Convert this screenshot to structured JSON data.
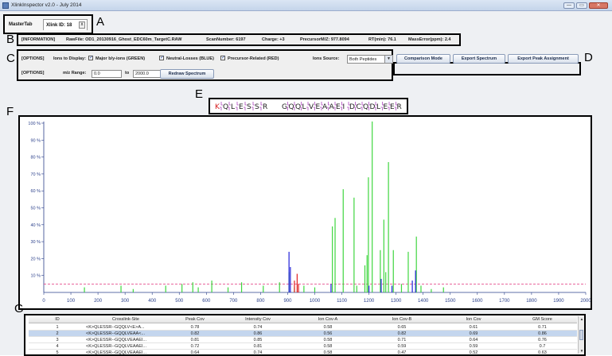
{
  "window": {
    "title": "XlinkInspector v2.0 - July 2014",
    "minimize_glyph": "—",
    "maximize_glyph": "▭",
    "close_glyph": "✕"
  },
  "tabs": {
    "master": "MasterTab",
    "xlink": "Xlink ID: 18",
    "close_glyph": "x"
  },
  "callouts": {
    "A": "A",
    "B": "B",
    "C": "C",
    "D": "D",
    "E": "E",
    "F": "F",
    "G": "G"
  },
  "info": {
    "tag": "[INFORMATION]",
    "rawfile": "RawFile: OD1_20130916_Ghost_EDC60m_TargetC.RAW",
    "scan": "ScanNumber: 6197",
    "charge": "Charge: +3",
    "precursor": "PrecursorM/Z: 977.8094",
    "rt": "RT(min): 76.1",
    "mass_error": "MassError(ppm): 2.4"
  },
  "options": {
    "tag1": "[OPTIONS]",
    "ions_to_display": "Ions to Display:",
    "chk_major": "Major b/y-ions (GREEN)",
    "chk_neutral": "Neutral-Losses (BLUE)",
    "chk_precursor": "Precursor-Related (RED)",
    "check_glyph": "✓",
    "ions_source": "Ions Source:",
    "source_value": "Both Peptides",
    "dropdown_glyph": "▼",
    "tag2": "[OPTIONS]",
    "mz_range": "m/z Range:",
    "from": "0.0",
    "to_label": "to",
    "to": "2000.0",
    "redraw": "Redraw Spectrum"
  },
  "actions": {
    "comparison": "Comparison Mode",
    "export_spectrum": "Export Spectrum",
    "export_peak": "Export Peak Assignment"
  },
  "peptide": {
    "letters": [
      "K",
      "Q",
      "L",
      "E",
      "S",
      "S",
      "R",
      "G",
      "Q",
      "Q",
      "L",
      "V",
      "E",
      "A",
      "A",
      "E",
      "I",
      "D",
      "C",
      "Q",
      "D",
      "L",
      "E",
      "E",
      "R"
    ],
    "crosslink_color": "#d62020",
    "bracket_color": "#b04ac0"
  },
  "chart_data": {
    "type": "bar",
    "title": "",
    "xlabel": "",
    "ylabel": "",
    "xlim": [
      0,
      2000
    ],
    "ylim": [
      0,
      100
    ],
    "xticks": [
      "0",
      "100",
      "200",
      "300",
      "400",
      "500",
      "600",
      "700",
      "800",
      "900",
      "1000",
      "1100",
      "1200",
      "1300",
      "1400",
      "1500",
      "1600",
      "1700",
      "1800",
      "1900",
      "2000"
    ],
    "yticks": [
      "10 %",
      "20 %",
      "30 %",
      "40 %",
      "50 %",
      "60 %",
      "70 %",
      "80 %",
      "90 %",
      "100 %"
    ],
    "threshold": 5,
    "threshold_color": "#e0307c",
    "series": [
      {
        "color": "#3fd63f",
        "peaks": [
          [
            150,
            3
          ],
          [
            285,
            4
          ],
          [
            330,
            2
          ],
          [
            450,
            4
          ],
          [
            510,
            5
          ],
          [
            550,
            6
          ],
          [
            570,
            3
          ],
          [
            620,
            7
          ],
          [
            680,
            3
          ],
          [
            730,
            6
          ],
          [
            810,
            4
          ],
          [
            870,
            6
          ],
          [
            905,
            12
          ],
          [
            925,
            3
          ],
          [
            960,
            4
          ],
          [
            1000,
            3
          ],
          [
            1065,
            39
          ],
          [
            1075,
            44
          ],
          [
            1105,
            61
          ],
          [
            1145,
            56
          ],
          [
            1155,
            4
          ],
          [
            1185,
            16
          ],
          [
            1193,
            22
          ],
          [
            1198,
            68
          ],
          [
            1212,
            101
          ],
          [
            1242,
            25
          ],
          [
            1255,
            43
          ],
          [
            1262,
            12
          ],
          [
            1272,
            77
          ],
          [
            1290,
            25
          ],
          [
            1320,
            5
          ],
          [
            1345,
            24
          ],
          [
            1375,
            33
          ],
          [
            1392,
            4
          ],
          [
            1430,
            2
          ],
          [
            1475,
            3
          ]
        ]
      },
      {
        "color": "#2020d8",
        "peaks": [
          [
            905,
            24
          ],
          [
            910,
            15
          ],
          [
            1060,
            5
          ],
          [
            1200,
            4
          ],
          [
            1245,
            8
          ],
          [
            1285,
            4
          ],
          [
            1360,
            7
          ],
          [
            1372,
            13
          ]
        ]
      },
      {
        "color": "#e02020",
        "peaks": [
          [
            925,
            7
          ],
          [
            935,
            11
          ],
          [
            940,
            5
          ]
        ]
      }
    ]
  },
  "table": {
    "columns": [
      "ID",
      "Crosslink-Site",
      "Peak Cov",
      "Intensity Cov",
      "Ion Cov-A",
      "Ion Cov-B",
      "Ion Cov",
      "GM Score"
    ],
    "rows": [
      [
        "1",
        "<K>QLESSR--GQQLV<E>A...",
        "0.78",
        "0.74",
        "0.58",
        "0.65",
        "0.61",
        "0.71"
      ],
      [
        "2",
        "<K>QLESSR--GQQLVEAA<...",
        "0.82",
        "0.86",
        "0.56",
        "0.82",
        "0.69",
        "0.86"
      ],
      [
        "3",
        "<K>QLESSR--GQQLVEAAEI...",
        "0.81",
        "0.85",
        "0.58",
        "0.71",
        "0.64",
        "0.76"
      ],
      [
        "4",
        "<K>QLESSR--GQQLVEAAEI...",
        "0.72",
        "0.81",
        "0.58",
        "0.59",
        "0.59",
        "0.7"
      ],
      [
        "5",
        "<K>QLESSR--GQQLVEAAEI...",
        "0.64",
        "0.74",
        "0.58",
        "0.47",
        "0.52",
        "0.63"
      ]
    ],
    "selected_row": 1,
    "scroll_up": "▲",
    "scroll_down": "▼"
  }
}
